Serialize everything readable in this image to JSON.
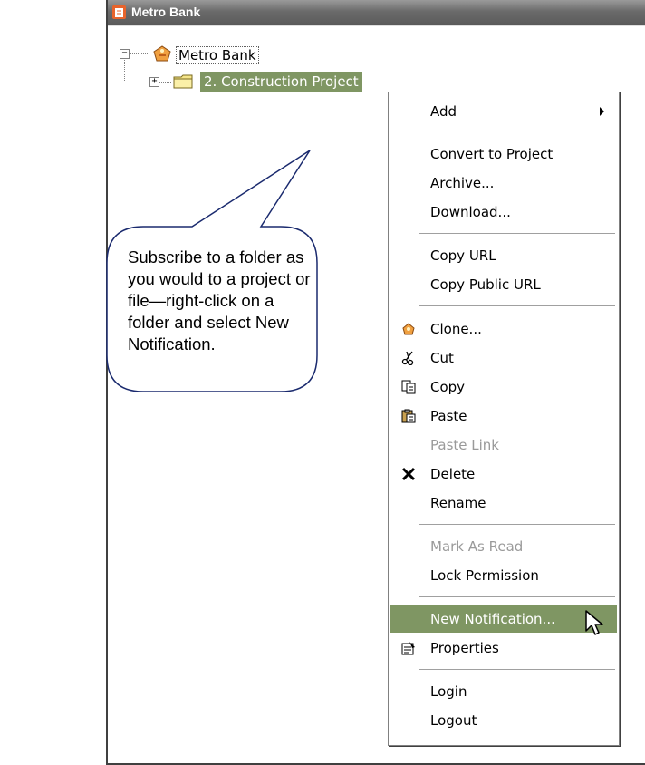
{
  "window": {
    "title": "Metro Bank"
  },
  "tree": {
    "root": {
      "label": "Metro Bank",
      "expander": "−"
    },
    "child": {
      "label": "2. Construction Project",
      "expander": "+"
    }
  },
  "menu": {
    "add": "Add",
    "convert": "Convert to Project",
    "archive": "Archive...",
    "download": "Download...",
    "copy_url": "Copy URL",
    "copy_public_url": "Copy Public URL",
    "clone": "Clone...",
    "cut": "Cut",
    "copy": "Copy",
    "paste": "Paste",
    "paste_link": "Paste Link",
    "delete": "Delete",
    "rename": "Rename",
    "mark_as_read": "Mark As Read",
    "lock_permission": "Lock Permission",
    "new_notification": "New Notification...",
    "properties": "Properties",
    "login": "Login",
    "logout": "Logout"
  },
  "callout": {
    "text": "Subscribe to a folder as you would to a project or file—right-click on a folder and select New Notification."
  },
  "colors": {
    "selection": "#7f9663",
    "titlebar": "#6a6a6a"
  }
}
